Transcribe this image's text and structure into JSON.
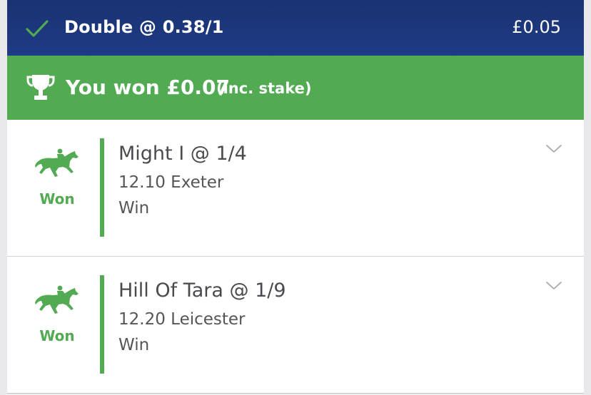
{
  "bet": {
    "title": "Double @ 0.38/1",
    "stake": "£0.05"
  },
  "result": {
    "headline": "You won £0.07",
    "note": "(inc. stake)"
  },
  "selections": [
    {
      "status": "Won",
      "runner": "Might I @ 1/4",
      "race": "12.10 Exeter",
      "market": "Win"
    },
    {
      "status": "Won",
      "runner": "Hill Of Tara @ 1/9",
      "race": "12.20 Leicester",
      "market": "Win"
    }
  ],
  "colors": {
    "header": "#1f3b86",
    "win_green": "#52aa52",
    "text": "#4a4a4f"
  },
  "icons": {
    "settled": "check-icon",
    "winnings": "trophy-icon",
    "sport": "horse-racing-icon",
    "expand": "chevron-down-icon"
  }
}
